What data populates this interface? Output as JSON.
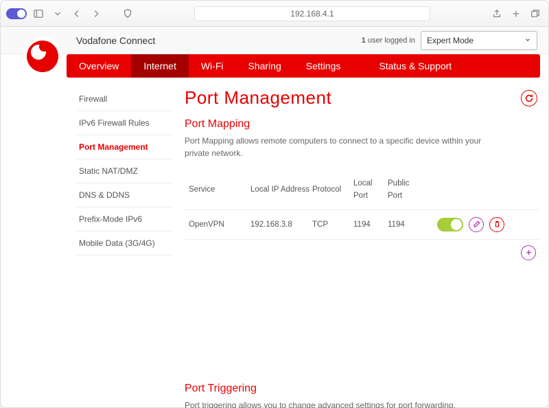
{
  "browser": {
    "address": "192.168.4.1"
  },
  "header": {
    "brand": "Vodafone Connect",
    "users_logged_in_count": "1",
    "users_logged_in_label": "user logged in",
    "mode_selected": "Expert Mode"
  },
  "nav": {
    "tabs": [
      {
        "label": "Overview",
        "active": false
      },
      {
        "label": "Internet",
        "active": true
      },
      {
        "label": "Wi-Fi",
        "active": false
      },
      {
        "label": "Sharing",
        "active": false
      },
      {
        "label": "Settings",
        "active": false
      },
      {
        "label": "Status & Support",
        "active": false
      }
    ]
  },
  "sidebar": {
    "items": [
      {
        "label": "Firewall",
        "active": false
      },
      {
        "label": "IPv6 Firewall Rules",
        "active": false
      },
      {
        "label": "Port Management",
        "active": true
      },
      {
        "label": "Static NAT/DMZ",
        "active": false
      },
      {
        "label": "DNS & DDNS",
        "active": false
      },
      {
        "label": "Prefix-Mode IPv6",
        "active": false
      },
      {
        "label": "Mobile Data (3G/4G)",
        "active": false
      }
    ]
  },
  "page": {
    "title": "Port Management",
    "mapping": {
      "heading": "Port Mapping",
      "description": "Port Mapping allows remote computers to connect to a specific device within your private network.",
      "columns": {
        "service": "Service",
        "local_ip": "Local IP Address",
        "protocol": "Protocol",
        "local_port": "Local Port",
        "public_port": "Public Port"
      },
      "rows": [
        {
          "service": "OpenVPN",
          "local_ip": "192.168.3.8",
          "protocol": "TCP",
          "local_port": "1194",
          "public_port": "1194",
          "enabled": true
        }
      ]
    },
    "triggering": {
      "heading": "Port Triggering",
      "description": "Port triggering allows you to change advanced settings for port forwarding."
    }
  }
}
